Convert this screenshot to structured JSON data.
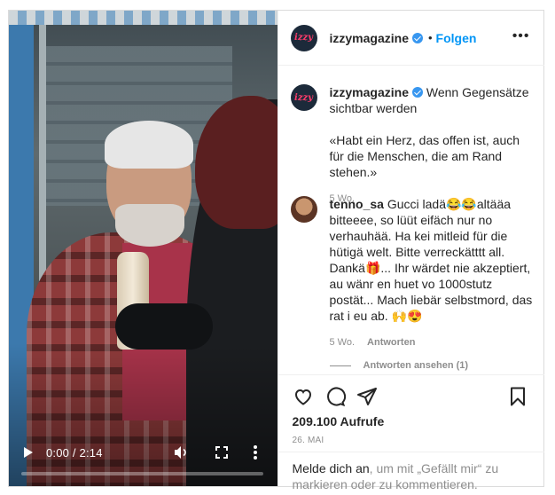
{
  "video": {
    "time_display": "0:00 / 2:14",
    "progress_fraction": 0.0,
    "icons": [
      "play-icon",
      "volume-icon",
      "fullscreen-icon",
      "more-vertical-icon"
    ]
  },
  "header": {
    "avatar_text": "izzy",
    "username": "izzymagazine",
    "separator": "•",
    "follow_label": "Folgen",
    "more_label": "•••"
  },
  "caption": {
    "avatar_text": "izzy",
    "username": "izzymagazine",
    "text_line1": "Wenn Gegensätze sichtbar werden",
    "text_line2": "«Habt ein Herz, das offen ist, auch für die Menschen, die am Rand stehen.»",
    "time": "5 Wo."
  },
  "comment": {
    "username": "tenno_sa",
    "text": "Gucci ladä😂😂altääa bitteeee, so lüüt eifäch nur no verhauhää. Ha kei mitleid für die hütigä welt. Bitte verreckätttt all. Dankä🎁... Ihr wärdet nie akzeptiert, au wänr en huet vo 1000stutz postät... Mach liebär selbstmord, das rat i eu ab. 🙌😍",
    "time": "5 Wo.",
    "reply_label": "Antworten",
    "view_replies": "Antworten ansehen (1)"
  },
  "actions": {
    "views": "209.100 Aufrufe",
    "date": "26. MAI",
    "login_link": "Melde dich an",
    "login_rest": ", um mit „Gefällt mir“ zu markieren oder zu kommentieren."
  },
  "colors": {
    "accent_blue": "#0095f6",
    "verified_blue": "#3897f0",
    "secondary_text": "#8e8e8e",
    "border": "#dbdbdb"
  }
}
